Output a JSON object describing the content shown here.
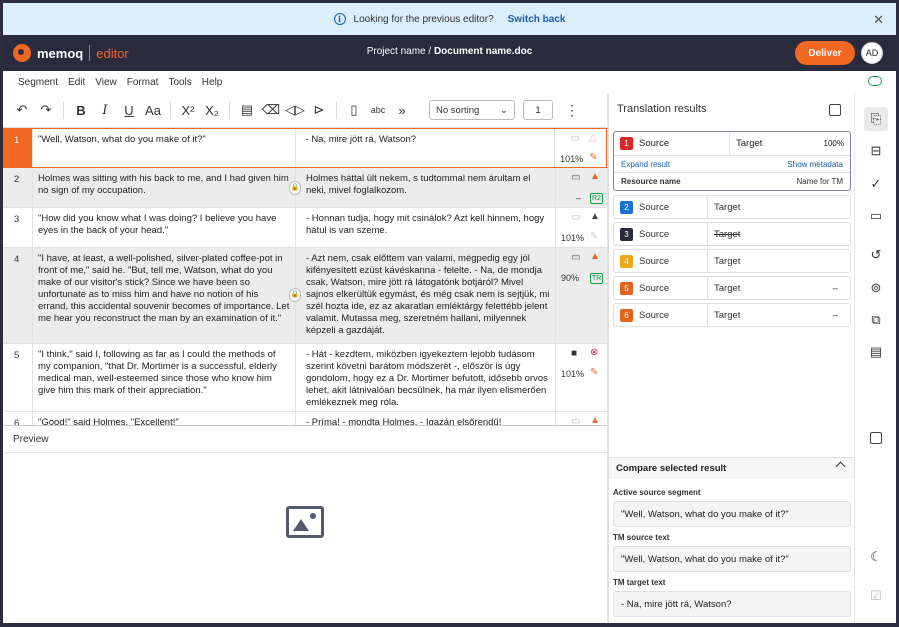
{
  "banner": {
    "text": "Looking for the previous editor?",
    "link": "Switch back",
    "info_icon": "i",
    "close_icon": "✕"
  },
  "appbar": {
    "brand": "memoq",
    "product": "editor",
    "project": "Project name",
    "sep": "/",
    "document": "Document name.doc",
    "deliver": "Deliver",
    "avatar": "AD"
  },
  "menu": [
    "Segment",
    "Edit",
    "View",
    "Format",
    "Tools",
    "Help"
  ],
  "toolbar": {
    "sort": "No sorting",
    "page": "1",
    "icons": [
      "undo-icon",
      "redo-icon",
      "bold-icon",
      "italic-icon",
      "underline-icon",
      "font-case-icon",
      "superscript-icon",
      "subscript-icon",
      "insert-icon",
      "clear-format-icon",
      "tag-icon",
      "tag-copy-icon",
      "paste-icon",
      "spellcheck-icon",
      "more-icon"
    ]
  },
  "segments": [
    {
      "n": "1",
      "src": "\"Well, Watson, what do you make of it?\"",
      "tgt": "- Na, mire jött rá, Watson?",
      "pct": "101%",
      "sel": true
    },
    {
      "n": "2",
      "src": "Holmes was sitting with his back to me, and I had given him no sign of my occupation.",
      "tgt": "Holmes háttal ült nekem, s tudtommal nem árultam el neki, mivel foglalkozom.",
      "pct": "–",
      "badge": "R2",
      "locked": true
    },
    {
      "n": "3",
      "src": "\"How did you know what I was doing? I believe you have eyes in the back of your head.\"",
      "tgt": "- Honnan tudja, hogy mit csinálok? Azt kell hinnem, hogy hátul is van szeme.",
      "pct": "101%"
    },
    {
      "n": "4",
      "src": "\"I have, at least, a well-polished, silver-plated coffee-pot in front of me,\" said he. \"But, tell me, Watson, what do you make of our visitor's stick? Since we have been so unfortunate as to miss him and have no notion of his errand, this accidental souvenir becomes of importance. Let me hear you reconstruct the man by an examination of it.\"",
      "tgt": "- Azt nem, csak előttem van valami, mégpedig egy jól kifényesített ezüst kávéskanna - felelte. - Na, de mondja csak, Watson, mire jött rá látogatónk botjáról? Mivel sajnos elkerültük egymást, és még csak nem is sejtjük, mi szél hozta ide, ez az akaratlan emléktárgy felettébb jelent valamit. Mutassa meg, szeretném hallani, milyennek képzeli a gazdáját.",
      "pct": "90%",
      "badge": "TR",
      "locked": true
    },
    {
      "n": "5",
      "src": "\"I think,\" said I, following as far as I could the methods of my companion, \"that Dr. Mortimer is a successful, elderly medical man, well-esteemed since those who know him give him this mark of their appreciation.\"",
      "tgt": "- Hát - kezdtem, miközben igyekeztem lejobb tudásom szerint követni barátom módszerét -, először is úgy gondolom, hogy ez a Dr. Mortimer befutott, idősebb orvos lehet, akit látnivalóan becsülnek, ha már ilyen elismerően emlékeznek meg róla.",
      "pct": "101%"
    },
    {
      "n": "6",
      "src": "\"Good!\" said Holmes. \"Excellent!\"",
      "tgt": "- Príma! - mondta Holmes. - Igazán elsőrendű!",
      "pct": ""
    }
  ],
  "preview": {
    "title": "Preview"
  },
  "results": {
    "title": "Translation results",
    "expand": "Expand result",
    "show_meta": "Show metadata",
    "resource": "Resource name",
    "tm": "Name for TM",
    "items": [
      {
        "n": "1",
        "src": "Source",
        "tgt": "Target",
        "r": "100%",
        "color": "#d9262c"
      },
      {
        "n": "2",
        "src": "Source",
        "tgt": "Target",
        "r": "",
        "color": "#1a73d4"
      },
      {
        "n": "3",
        "src": "Source",
        "tgt": "Target",
        "r": "",
        "color": "#2a2a3d"
      },
      {
        "n": "4",
        "src": "Source",
        "tgt": "Target",
        "r": "",
        "color": "#f0a71a"
      },
      {
        "n": "5",
        "src": "Source",
        "tgt": "Target",
        "r": "–",
        "color": "#e0661c"
      },
      {
        "n": "6",
        "src": "Source",
        "tgt": "Target",
        "r": "–",
        "color": "#e0661c"
      }
    ]
  },
  "compare": {
    "title": "Compare selected result",
    "l1": "Active source segment",
    "v1": "\"Well, Watson, what do you make of it?\"",
    "l2": "TM source text",
    "v2": "\"Well, Watson, what do you make of it?\"",
    "l3": "TM target text",
    "v3": "- Na, mire jött rá, Watson?"
  }
}
